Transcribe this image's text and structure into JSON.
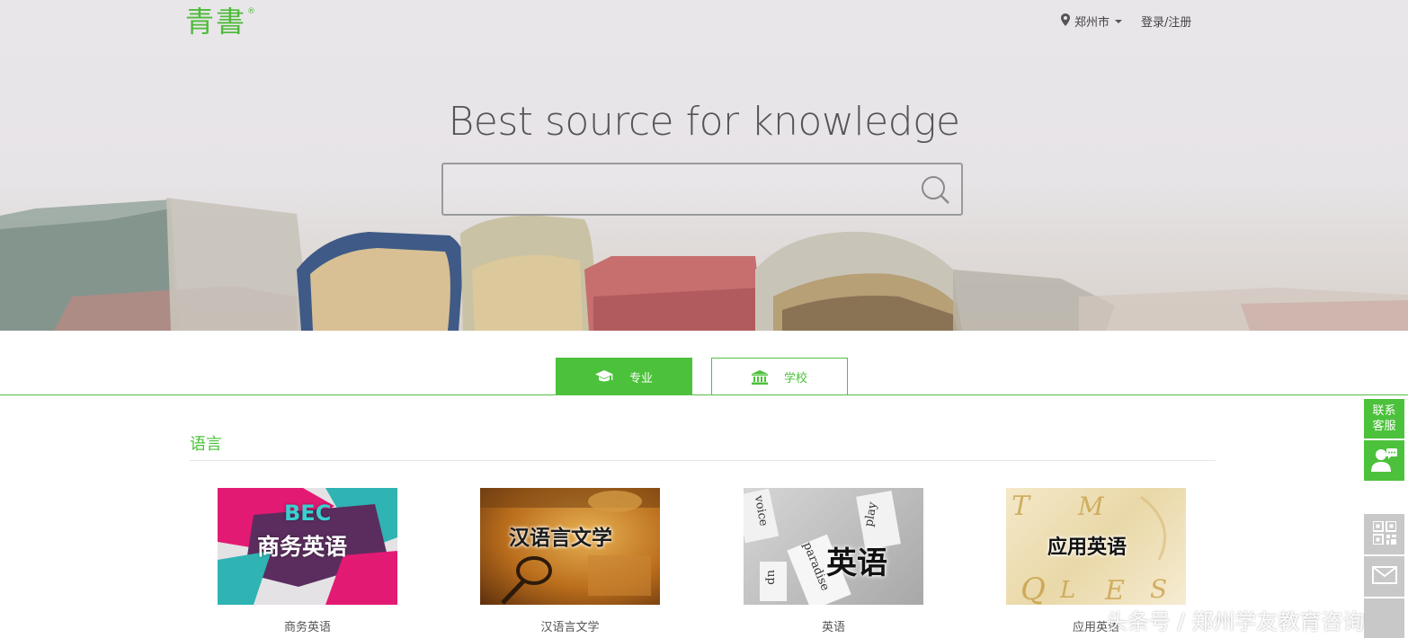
{
  "brand": {
    "logo_text": "青書",
    "registered_mark": "®"
  },
  "topnav": {
    "city": "郑州市",
    "login_register": "登录/注册"
  },
  "hero": {
    "headline": "Best source for knowledge"
  },
  "search": {
    "value": "",
    "placeholder": ""
  },
  "tabs": [
    {
      "label": "专业",
      "icon": "graduation-cap-icon",
      "active": true
    },
    {
      "label": "学校",
      "icon": "institution-icon",
      "active": false
    }
  ],
  "section": {
    "title": "语言",
    "items": [
      {
        "caption": "商务英语",
        "image_text_top": "BEC",
        "image_text_main": "商务英语"
      },
      {
        "caption": "汉语言文学",
        "image_text_main": "汉语言文学"
      },
      {
        "caption": "英语",
        "image_text_main": "英语",
        "image_words": [
          "voice",
          "play",
          "up",
          "paradise"
        ]
      },
      {
        "caption": "应用英语",
        "image_text_main": "应用英语"
      }
    ]
  },
  "sidebar": {
    "contact_label_1": "联系",
    "contact_label_2": "客服"
  },
  "watermark": "头条号 / 郑州学友教育咨询",
  "colors": {
    "accent": "#4cc13b",
    "side_gray": "#c8c8c8"
  }
}
